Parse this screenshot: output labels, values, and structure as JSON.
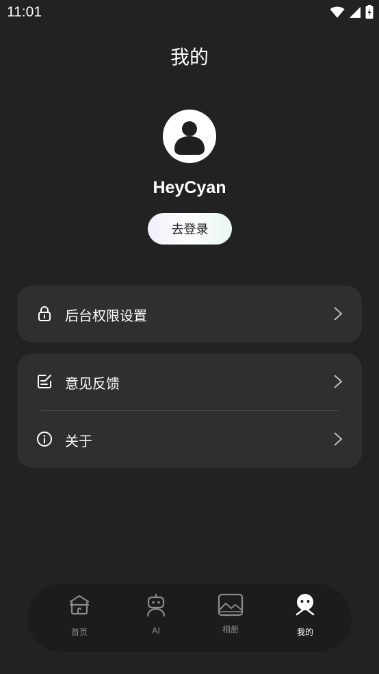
{
  "status_bar": {
    "time": "11:01"
  },
  "header": {
    "title": "我的"
  },
  "profile": {
    "username": "HeyCyan",
    "login_label": "去登录"
  },
  "menu": {
    "background_permissions": "后台权限设置",
    "feedback": "意见反馈",
    "about": "关于"
  },
  "bottom_nav": {
    "home": "首页",
    "ai": "AI",
    "album": "相册",
    "mine": "我的"
  },
  "colors": {
    "background": "#222223",
    "card": "#2f2f30",
    "nav": "#1c1c1d",
    "inactive": "#8c8c8e",
    "active": "#ffffff"
  }
}
